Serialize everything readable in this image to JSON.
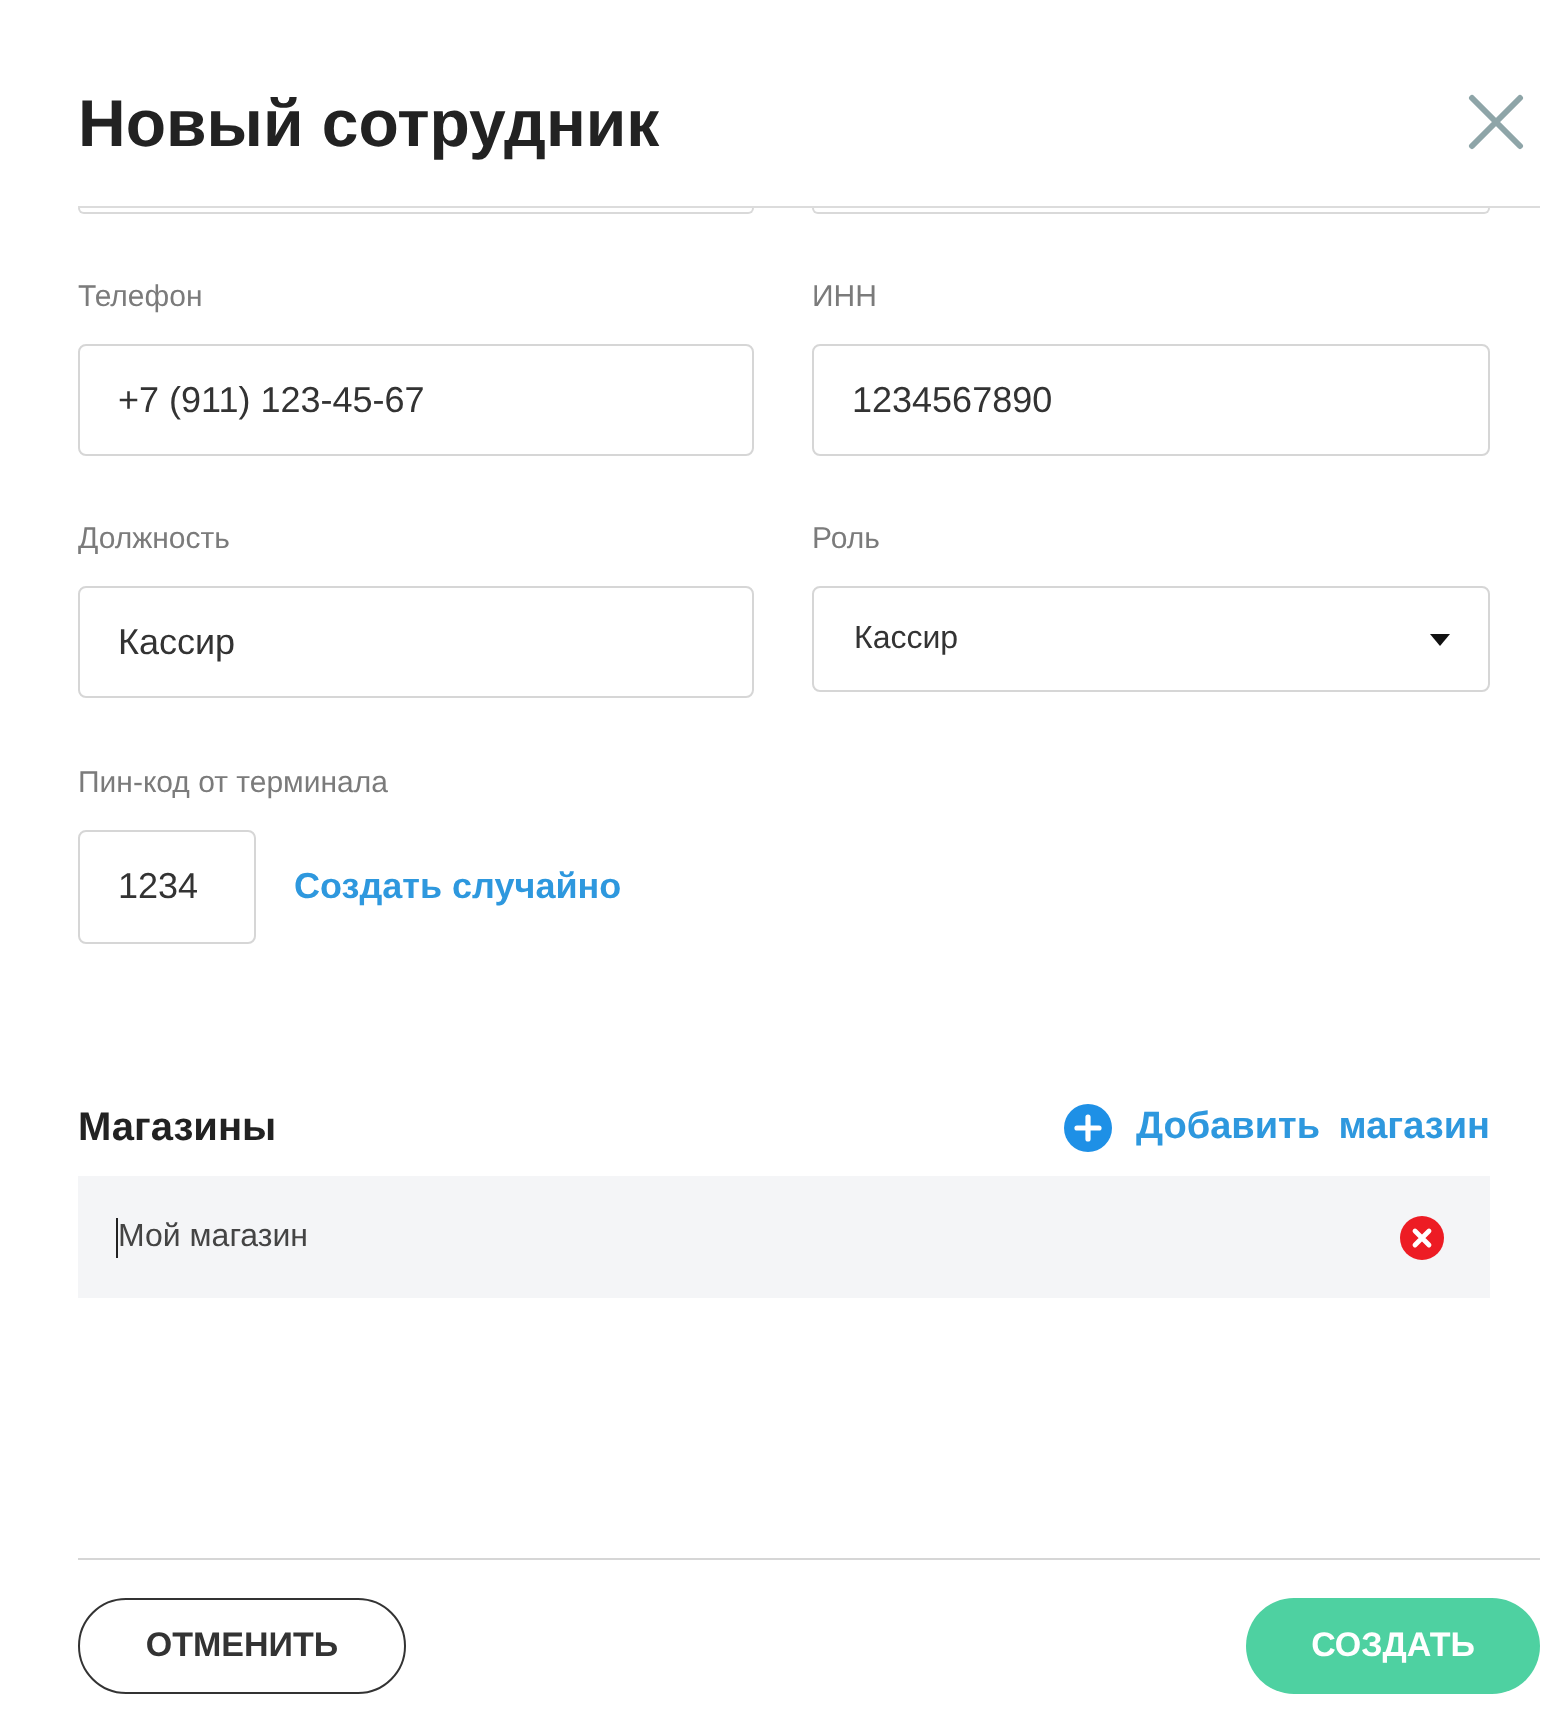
{
  "dialog": {
    "title": "Новый сотрудник"
  },
  "fields": [
    {
      "kind": "cut"
    },
    {
      "kind": "cut"
    },
    {
      "kind": "input",
      "label": "Телефон",
      "value": "+7 (911) 123-45-67"
    },
    {
      "kind": "input",
      "label": "ИНН",
      "value": "1234567890"
    },
    {
      "kind": "input",
      "label": "Должность",
      "value": "Кассир"
    },
    {
      "kind": "select",
      "label": "Роль",
      "value": "Кассир"
    }
  ],
  "pin": {
    "label": "Пин-код от терминала",
    "value": "1234",
    "generate_link": "Создать случайно"
  },
  "stores": {
    "title": "Магазины",
    "add_link": "Добавить магазин",
    "items": [
      {
        "name": "Мой магазин",
        "focused": true
      }
    ]
  },
  "footer": {
    "cancel": "ОТМЕНИТЬ",
    "submit": "СОЗДАТЬ"
  }
}
